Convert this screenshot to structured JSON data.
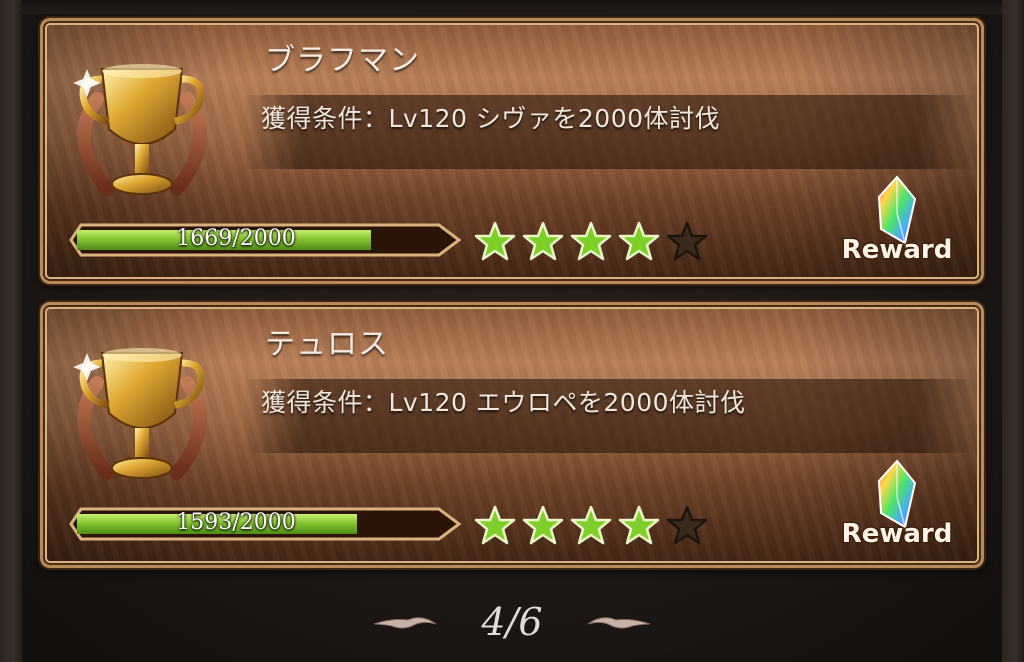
{
  "achievements": [
    {
      "title": "ブラフマン",
      "condition": "獲得条件：Lv120 シヴァを2000体討伐",
      "progress_text": "1669/2000",
      "progress_fraction": 0.8345,
      "stars_filled": 4,
      "stars_total": 5,
      "reward_label": "Reward"
    },
    {
      "title": "テュロス",
      "condition": "獲得条件：Lv120 エウロペを2000体討伐",
      "progress_text": "1593/2000",
      "progress_fraction": 0.7965,
      "stars_filled": 4,
      "stars_total": 5,
      "reward_label": "Reward"
    }
  ],
  "pagination": {
    "text": "4/6"
  },
  "icons": {
    "trophy": "gold-trophy-icon",
    "star": "star-icon",
    "reward": "rainbow-crystal-icon",
    "prev": "prev-page-arrow-icon",
    "next": "next-page-arrow-icon"
  },
  "colors": {
    "progress_fill": "#86c530",
    "star_filled": "#7fcf2a",
    "star_empty": "#3a2a1e",
    "card_border": "#b88a5a"
  }
}
